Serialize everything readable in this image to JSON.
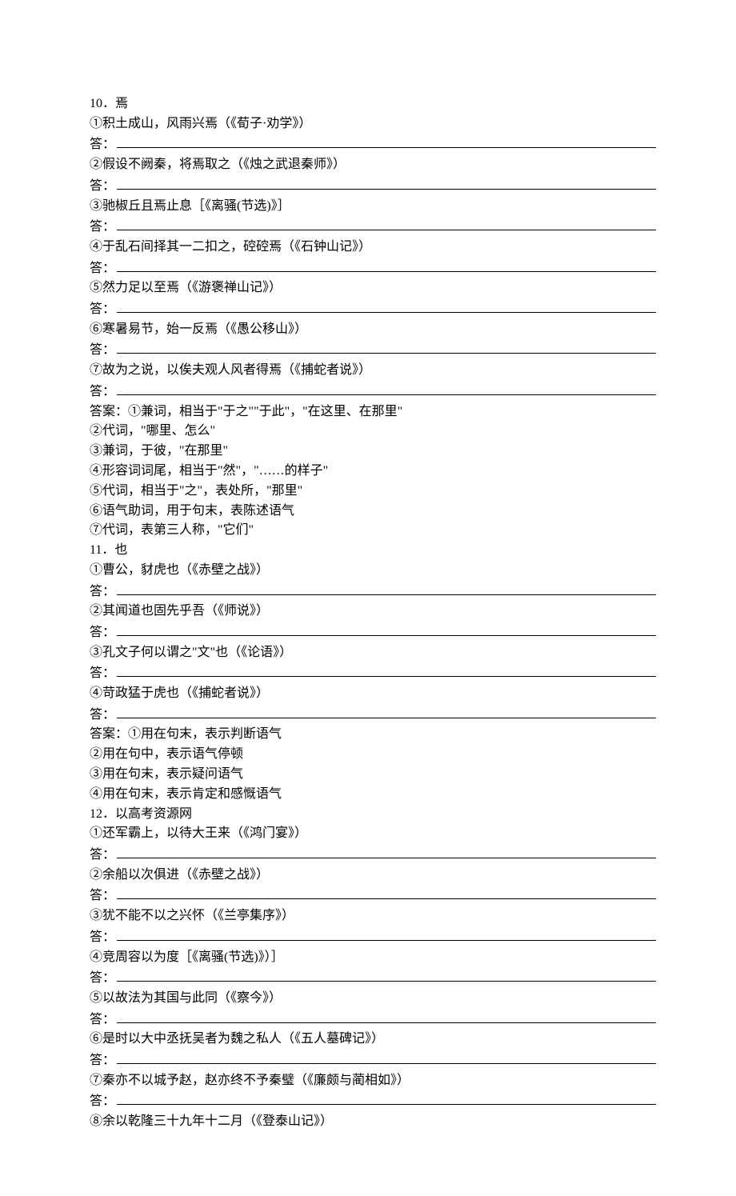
{
  "answerLabel": "答：",
  "answerPrefix": "答案：",
  "questions": [
    {
      "num": "10",
      "char": "焉",
      "items": [
        "①积土成山，风雨兴焉（《荀子·劝学》）",
        "②假设不阙秦，将焉取之（《烛之武退秦师》）",
        "③驰椒丘且焉止息［《离骚(节选)》］",
        "④于乱石间择其一二扣之，硿硿焉（《石钟山记》）",
        "⑤然力足以至焉（《游褒禅山记》）",
        "⑥寒暑易节，始一反焉（《愚公移山》）",
        "⑦故为之说，以俟夫观人风者得焉（《捕蛇者说》）"
      ],
      "answers": [
        "①兼词，相当于\"于之\"\"于此\"，\"在这里、在那里\"",
        "②代词，\"哪里、怎么\"",
        "③兼词，于彼，\"在那里\"",
        "④形容词词尾，相当于\"然\"，\"……的样子\"",
        "⑤代词，相当于\"之\"，表处所，\"那里\"",
        "⑥语气助词，用于句末，表陈述语气",
        "⑦代词，表第三人称，\"它们\""
      ]
    },
    {
      "num": "11",
      "char": "也",
      "items": [
        "①曹公，豺虎也（《赤壁之战》）",
        "②其闻道也固先乎吾（《师说》）",
        "③孔文子何以谓之\"文\"也（《论语》）",
        "④苛政猛于虎也（《捕蛇者说》）"
      ],
      "answers": [
        "①用在句末，表示判断语气",
        "②用在句中，表示语气停顿",
        "③用在句末，表示疑问语气",
        "④用在句末，表示肯定和感慨语气"
      ]
    },
    {
      "num": "12",
      "char": "以高考资源网",
      "items": [
        "①还军霸上，以待大王来（《鸿门宴》）",
        "②余船以次俱进（《赤壁之战》）",
        "③犹不能不以之兴怀（《兰亭集序》）",
        "④竞周容以为度［《离骚(节选)》）］",
        "⑤以故法为其国与此同（《察今》）",
        "⑥是时以大中丞抚吴者为魏之私人（《五人墓碑记》）",
        "⑦秦亦不以城予赵，赵亦终不予秦璧（《廉颇与蔺相如》）",
        "⑧余以乾隆三十九年十二月（《登泰山记》）"
      ],
      "itemsNoBlankLast": true,
      "answers": []
    }
  ]
}
